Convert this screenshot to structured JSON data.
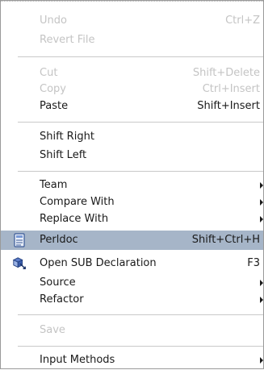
{
  "menu": {
    "undo": {
      "label": "Undo",
      "accel": "Ctrl+Z"
    },
    "revert": {
      "label": "Revert File"
    },
    "cut": {
      "label": "Cut",
      "accel": "Shift+Delete"
    },
    "copy": {
      "label": "Copy",
      "accel": "Ctrl+Insert"
    },
    "paste": {
      "label": "Paste",
      "accel": "Shift+Insert"
    },
    "shift_right": {
      "label": "Shift Right"
    },
    "shift_left": {
      "label": "Shift Left"
    },
    "team": {
      "label": "Team"
    },
    "compare": {
      "label": "Compare With"
    },
    "replace": {
      "label": "Replace With"
    },
    "perldoc": {
      "label": "Perldoc",
      "accel": "Shift+Ctrl+H",
      "icon": "document-icon"
    },
    "open_sub": {
      "label": "Open SUB Declaration",
      "accel": "F3",
      "icon": "open-declaration-icon"
    },
    "source": {
      "label": "Source"
    },
    "refactor": {
      "label": "Refactor"
    },
    "save": {
      "label": "Save"
    },
    "input_methods": {
      "label": "Input Methods"
    }
  },
  "colors": {
    "highlight": "#a6b5c8",
    "disabled_text": "#c4c4c4",
    "text": "#1a1a1a"
  }
}
